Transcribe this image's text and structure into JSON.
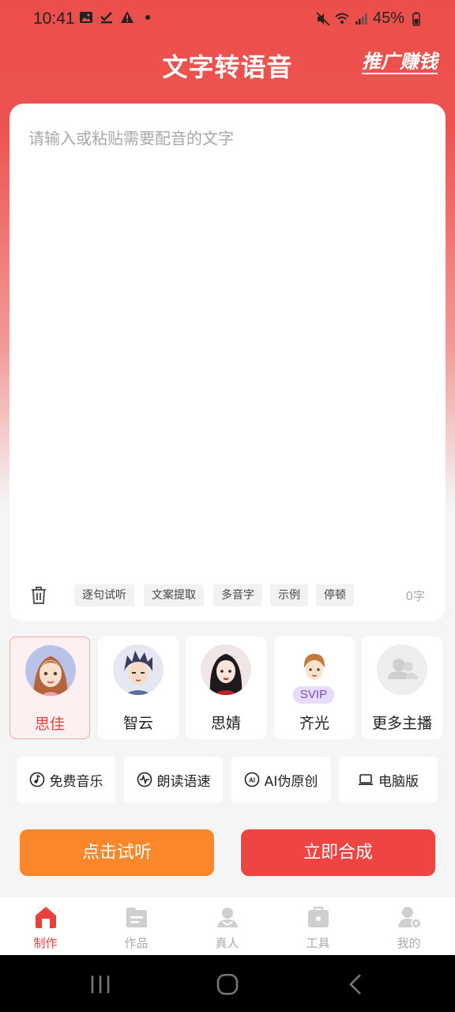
{
  "status_bar": {
    "time": "10:41",
    "battery": "45%"
  },
  "header": {
    "title": "文字转语音",
    "promo_link": "推广赚钱"
  },
  "editor": {
    "placeholder": "请输入或粘贴需要配音的文字",
    "chips": [
      "逐句试听",
      "文案提取",
      "多音字",
      "示例",
      "停顿"
    ],
    "char_count": "0字"
  },
  "voices": [
    {
      "name": "思佳",
      "selected": true
    },
    {
      "name": "智云",
      "selected": false
    },
    {
      "name": "思婧",
      "selected": false
    },
    {
      "name": "齐光",
      "selected": false,
      "badge": "SVIP"
    },
    {
      "name": "更多主播",
      "selected": false
    }
  ],
  "features": [
    {
      "label": "免费音乐",
      "icon": "music-note-icon"
    },
    {
      "label": "朗读语速",
      "icon": "speed-wave-icon"
    },
    {
      "label": "AI伪原创",
      "icon": "ai-icon"
    },
    {
      "label": "电脑版",
      "icon": "laptop-icon"
    }
  ],
  "actions": {
    "listen": "点击试听",
    "synthesize": "立即合成"
  },
  "tabs": [
    {
      "label": "制作",
      "icon": "home-icon",
      "active": true
    },
    {
      "label": "作品",
      "icon": "folder-icon",
      "active": false
    },
    {
      "label": "真人",
      "icon": "person-icon",
      "active": false
    },
    {
      "label": "工具",
      "icon": "toolbox-icon",
      "active": false
    },
    {
      "label": "我的",
      "icon": "user-settings-icon",
      "active": false
    }
  ],
  "colors": {
    "brand_red": "#ec4f4b",
    "listen_orange": "#fc862a",
    "synth_red": "#ee4542",
    "svip_purple": "#7b4cc9"
  }
}
